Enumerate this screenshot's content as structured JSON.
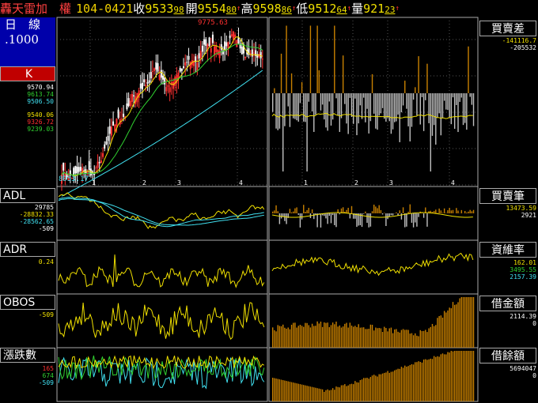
{
  "header": {
    "index_name": "轟天雷加　權",
    "date": "104-0421",
    "close_label": "收",
    "close_value": "9533",
    "close_change": "98",
    "open_label": "開",
    "open_value": "9554",
    "open_change": "80",
    "high_label": "高",
    "high_value": "9598",
    "high_change": "86",
    "low_label": "低",
    "low_value": "9512",
    "low_change": "64",
    "volume_label": "量",
    "volume_value": "921",
    "volume_change": "23"
  },
  "period": {
    "line1": "日　線",
    "line2": ".1000"
  },
  "left_panels": {
    "k": {
      "label": "K",
      "values": [
        "9570.94",
        "9613.74",
        "9506.50",
        "9540.06",
        "9326.72",
        "9239.03"
      ],
      "high_note": "9775.63",
      "low_note": "8953.17"
    },
    "adl": {
      "label": "ADL",
      "values": [
        "29785",
        "-28832.33",
        "-28562.65",
        "-509"
      ]
    },
    "adr": {
      "label": "ADR",
      "values": [
        "0.24"
      ]
    },
    "obos": {
      "label": "OBOS",
      "values": [
        "-509"
      ]
    },
    "updown": {
      "label": "漲跌數",
      "values": [
        "165",
        "674",
        "-509"
      ]
    }
  },
  "right_panels": {
    "spread": {
      "label": "買賣差",
      "values": [
        "-141116.7",
        "-205532"
      ]
    },
    "count": {
      "label": "買賣筆",
      "values": [
        "13473.59",
        "2921"
      ]
    },
    "margin_rate": {
      "label": "資維率",
      "values": [
        "162.01",
        "3495.55",
        "2157.39"
      ]
    },
    "loan_amt": {
      "label": "借金額",
      "values": [
        "2114.39",
        "0"
      ]
    },
    "loan_bal": {
      "label": "借餘額",
      "values": [
        "5694047",
        "0"
      ]
    }
  },
  "x_ticks": [
    "1",
    "2",
    "3",
    "4"
  ],
  "colors": {
    "yellow": "#f0e000",
    "orange": "#c88000",
    "cyan": "#40e0f0",
    "green": "#30d030",
    "white": "#ffffff",
    "red": "#ff3030",
    "gray": "#aaaaaa",
    "blue": "#0000aa"
  }
}
